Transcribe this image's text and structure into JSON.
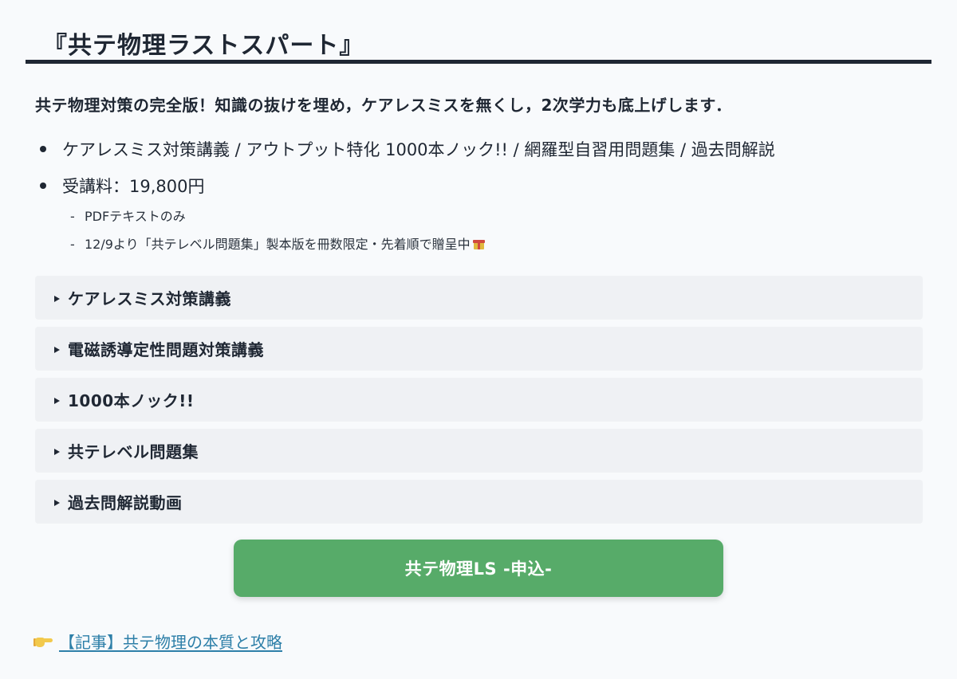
{
  "title": "『共テ物理ラストスパート』",
  "lead": "共テ物理対策の完全版！知識の抜けを埋め，ケアレスミスを無くし，2次学力も底上げします．",
  "bullets": [
    "ケアレスミス対策講義 / アウトプット特化 1000本ノック!! / 網羅型自習用問題集 / 過去問解説",
    "受講料：19,800円"
  ],
  "sub_bullets": [
    "PDFテキストのみ",
    "12/9より「共テレベル問題集」製本版を冊数限定・先着順で贈呈中"
  ],
  "sub_bullet_marker": "-",
  "accordions": [
    {
      "label": "ケアレスミス対策講義"
    },
    {
      "label": "電磁誘導定性問題対策講義"
    },
    {
      "label": "1000本ノック!!"
    },
    {
      "label": "共テレベル問題集"
    },
    {
      "label": "過去問解説動画"
    }
  ],
  "cta": {
    "label": "共テ物理LS -申込-",
    "color": "#57ab69"
  },
  "footer_link": {
    "label": "【記事】共テ物理の本質と攻略",
    "icon": "pointing-hand-icon",
    "color": "#2d7fa8"
  },
  "icons": {
    "gift": "gift-icon",
    "accordion_marker": "triangle-right-icon"
  }
}
